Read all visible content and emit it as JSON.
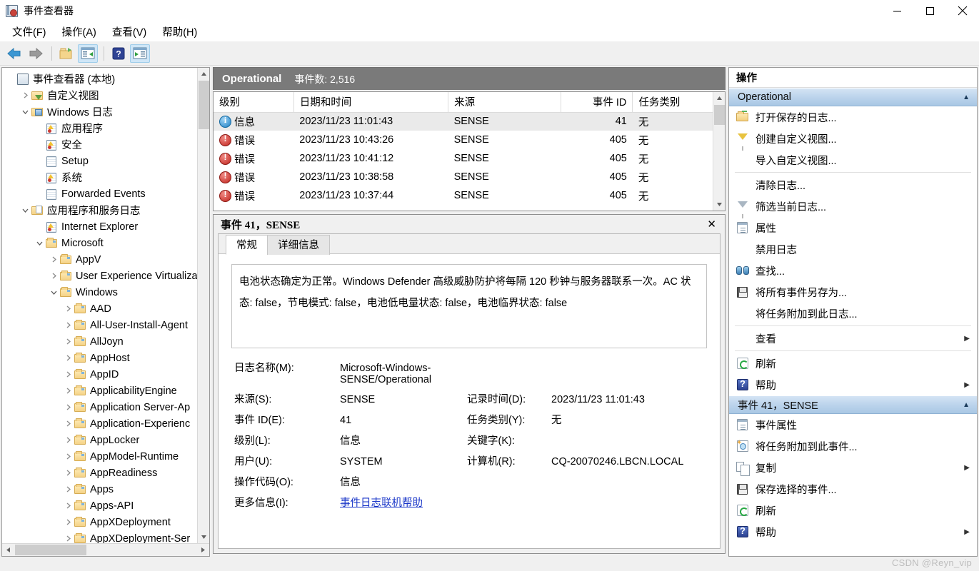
{
  "window": {
    "title": "事件查看器",
    "app_icon": "event-viewer-icon",
    "minimize": "—",
    "maximize": "□",
    "close": "✕"
  },
  "menubar": {
    "items": [
      {
        "label": "文件(F)"
      },
      {
        "label": "操作(A)"
      },
      {
        "label": "查看(V)"
      },
      {
        "label": "帮助(H)"
      }
    ]
  },
  "toolbar": {
    "buttons": [
      {
        "name": "back-arrow-icon",
        "active": false
      },
      {
        "name": "forward-arrow-icon",
        "active": false
      },
      {
        "name": "open-saved-log-icon",
        "active": false
      },
      {
        "name": "show-hide-console-tree-icon",
        "active": true
      },
      {
        "name": "help-icon",
        "active": false
      },
      {
        "name": "show-hide-action-pane-icon",
        "active": true
      }
    ]
  },
  "tree": {
    "items": [
      {
        "label": "事件查看器 (本地)",
        "indent": 0,
        "twisty": "none",
        "icon": "event-viewer-icon"
      },
      {
        "label": "自定义视图",
        "indent": 1,
        "twisty": "collapsed",
        "icon": "custom-view-folder-icon"
      },
      {
        "label": "Windows 日志",
        "indent": 1,
        "twisty": "expanded",
        "icon": "windows-logs-folder-icon"
      },
      {
        "label": "应用程序",
        "indent": 2,
        "twisty": "none",
        "icon": "log-icon"
      },
      {
        "label": "安全",
        "indent": 2,
        "twisty": "none",
        "icon": "log-icon"
      },
      {
        "label": "Setup",
        "indent": 2,
        "twisty": "none",
        "icon": "log-plain-icon"
      },
      {
        "label": "系统",
        "indent": 2,
        "twisty": "none",
        "icon": "log-icon"
      },
      {
        "label": "Forwarded Events",
        "indent": 2,
        "twisty": "none",
        "icon": "log-plain-icon"
      },
      {
        "label": "应用程序和服务日志",
        "indent": 1,
        "twisty": "expanded",
        "icon": "app-services-folder-icon"
      },
      {
        "label": "Internet Explorer",
        "indent": 2,
        "twisty": "none",
        "icon": "log-icon"
      },
      {
        "label": "Microsoft",
        "indent": 2,
        "twisty": "expanded",
        "icon": "folder-icon"
      },
      {
        "label": "AppV",
        "indent": 3,
        "twisty": "collapsed",
        "icon": "folder-icon"
      },
      {
        "label": "User Experience Virtualiza",
        "indent": 3,
        "twisty": "collapsed",
        "icon": "folder-icon"
      },
      {
        "label": "Windows",
        "indent": 3,
        "twisty": "expanded",
        "icon": "folder-icon"
      },
      {
        "label": "AAD",
        "indent": 4,
        "twisty": "collapsed",
        "icon": "folder-icon"
      },
      {
        "label": "All-User-Install-Agent",
        "indent": 4,
        "twisty": "collapsed",
        "icon": "folder-icon"
      },
      {
        "label": "AllJoyn",
        "indent": 4,
        "twisty": "collapsed",
        "icon": "folder-icon"
      },
      {
        "label": "AppHost",
        "indent": 4,
        "twisty": "collapsed",
        "icon": "folder-icon"
      },
      {
        "label": "AppID",
        "indent": 4,
        "twisty": "collapsed",
        "icon": "folder-icon"
      },
      {
        "label": "ApplicabilityEngine",
        "indent": 4,
        "twisty": "collapsed",
        "icon": "folder-icon"
      },
      {
        "label": "Application Server-Ap",
        "indent": 4,
        "twisty": "collapsed",
        "icon": "folder-icon"
      },
      {
        "label": "Application-Experienc",
        "indent": 4,
        "twisty": "collapsed",
        "icon": "folder-icon"
      },
      {
        "label": "AppLocker",
        "indent": 4,
        "twisty": "collapsed",
        "icon": "folder-icon"
      },
      {
        "label": "AppModel-Runtime",
        "indent": 4,
        "twisty": "collapsed",
        "icon": "folder-icon"
      },
      {
        "label": "AppReadiness",
        "indent": 4,
        "twisty": "collapsed",
        "icon": "folder-icon"
      },
      {
        "label": "Apps",
        "indent": 4,
        "twisty": "collapsed",
        "icon": "folder-icon"
      },
      {
        "label": "Apps-API",
        "indent": 4,
        "twisty": "collapsed",
        "icon": "folder-icon"
      },
      {
        "label": "AppXDeployment",
        "indent": 4,
        "twisty": "collapsed",
        "icon": "folder-icon"
      },
      {
        "label": "AppXDeployment-Ser",
        "indent": 4,
        "twisty": "collapsed",
        "icon": "folder-icon"
      }
    ]
  },
  "center": {
    "header": {
      "title": "Operational",
      "count_label": "事件数: 2,516"
    },
    "list": {
      "columns": [
        "级别",
        "日期和时间",
        "来源",
        "事件 ID",
        "任务类别"
      ],
      "rows": [
        {
          "level_icon": "info-icon",
          "level": "信息",
          "datetime": "2023/11/23 11:01:43",
          "source": "SENSE",
          "event_id": "41",
          "task": "无",
          "selected": true
        },
        {
          "level_icon": "error-icon",
          "level": "错误",
          "datetime": "2023/11/23 10:43:26",
          "source": "SENSE",
          "event_id": "405",
          "task": "无",
          "selected": false
        },
        {
          "level_icon": "error-icon",
          "level": "错误",
          "datetime": "2023/11/23 10:41:12",
          "source": "SENSE",
          "event_id": "405",
          "task": "无",
          "selected": false
        },
        {
          "level_icon": "error-icon",
          "level": "错误",
          "datetime": "2023/11/23 10:38:58",
          "source": "SENSE",
          "event_id": "405",
          "task": "无",
          "selected": false
        },
        {
          "level_icon": "error-icon",
          "level": "错误",
          "datetime": "2023/11/23 10:37:44",
          "source": "SENSE",
          "event_id": "405",
          "task": "无",
          "selected": false
        }
      ]
    },
    "details": {
      "title": "事件 41，SENSE",
      "close_label": "✕",
      "tabs": [
        {
          "label": "常规",
          "active": true
        },
        {
          "label": "详细信息",
          "active": false
        }
      ],
      "description": "电池状态确定为正常。Windows Defender 高级威胁防护将每隔 120 秒钟与服务器联系一次。AC 状态: false，节电模式: false，电池低电量状态: false，电池临界状态: false",
      "fields": [
        {
          "label1": "日志名称(M):",
          "value1": "Microsoft-Windows-SENSE/Operational",
          "label2": "",
          "value2": ""
        },
        {
          "label1": "来源(S):",
          "value1": "SENSE",
          "label2": "记录时间(D):",
          "value2": "2023/11/23 11:01:43"
        },
        {
          "label1": "事件 ID(E):",
          "value1": "41",
          "label2": "任务类别(Y):",
          "value2": "无"
        },
        {
          "label1": "级别(L):",
          "value1": "信息",
          "label2": "关键字(K):",
          "value2": ""
        },
        {
          "label1": "用户(U):",
          "value1": "SYSTEM",
          "label2": "计算机(R):",
          "value2": "CQ-20070246.LBCN.LOCAL"
        },
        {
          "label1": "操作代码(O):",
          "value1": "信息",
          "label2": "",
          "value2": ""
        }
      ],
      "more_info_label": "更多信息(I):",
      "more_info_link": "事件日志联机帮助"
    }
  },
  "actions": {
    "title": "操作",
    "sections": [
      {
        "header": "Operational",
        "caret": "▲",
        "items": [
          {
            "label": "打开保存的日志...",
            "icon": "open-saved-log-icon",
            "submenu": false,
            "sep_after": false
          },
          {
            "label": "创建自定义视图...",
            "icon": "create-custom-view-icon",
            "submenu": false,
            "sep_after": false
          },
          {
            "label": "导入自定义视图...",
            "icon": "none",
            "submenu": false,
            "sep_after": true
          },
          {
            "label": "清除日志...",
            "icon": "none",
            "submenu": false,
            "sep_after": false
          },
          {
            "label": "筛选当前日志...",
            "icon": "filter-icon",
            "submenu": false,
            "sep_after": false
          },
          {
            "label": "属性",
            "icon": "properties-icon",
            "submenu": false,
            "sep_after": false
          },
          {
            "label": "禁用日志",
            "icon": "none",
            "submenu": false,
            "sep_after": false
          },
          {
            "label": "查找...",
            "icon": "find-icon",
            "submenu": false,
            "sep_after": false
          },
          {
            "label": "将所有事件另存为...",
            "icon": "save-icon",
            "submenu": false,
            "sep_after": false
          },
          {
            "label": "将任务附加到此日志...",
            "icon": "none",
            "submenu": false,
            "sep_after": true
          },
          {
            "label": "查看",
            "icon": "none",
            "submenu": true,
            "sep_after": true
          },
          {
            "label": "刷新",
            "icon": "refresh-icon",
            "submenu": false,
            "sep_after": false
          },
          {
            "label": "帮助",
            "icon": "help-icon",
            "submenu": true,
            "sep_after": false
          }
        ]
      },
      {
        "header": "事件 41，SENSE",
        "caret": "▲",
        "items": [
          {
            "label": "事件属性",
            "icon": "properties-icon",
            "submenu": false,
            "sep_after": false
          },
          {
            "label": "将任务附加到此事件...",
            "icon": "attach-task-icon",
            "submenu": false,
            "sep_after": false
          },
          {
            "label": "复制",
            "icon": "copy-icon",
            "submenu": true,
            "sep_after": false
          },
          {
            "label": "保存选择的事件...",
            "icon": "save-icon",
            "submenu": false,
            "sep_after": false
          },
          {
            "label": "刷新",
            "icon": "refresh-icon",
            "submenu": false,
            "sep_after": false
          },
          {
            "label": "帮助",
            "icon": "help-icon",
            "submenu": true,
            "sep_after": false
          }
        ]
      }
    ]
  },
  "watermark": "CSDN @Reyn_vip",
  "colors": {
    "header_bar": "#7a7a7a",
    "section_header_blue": "#bcd4ec",
    "selection": "#eaeaea",
    "link": "#1a36c8",
    "error_red": "#c0241d",
    "info_blue": "#1d7fc4"
  }
}
